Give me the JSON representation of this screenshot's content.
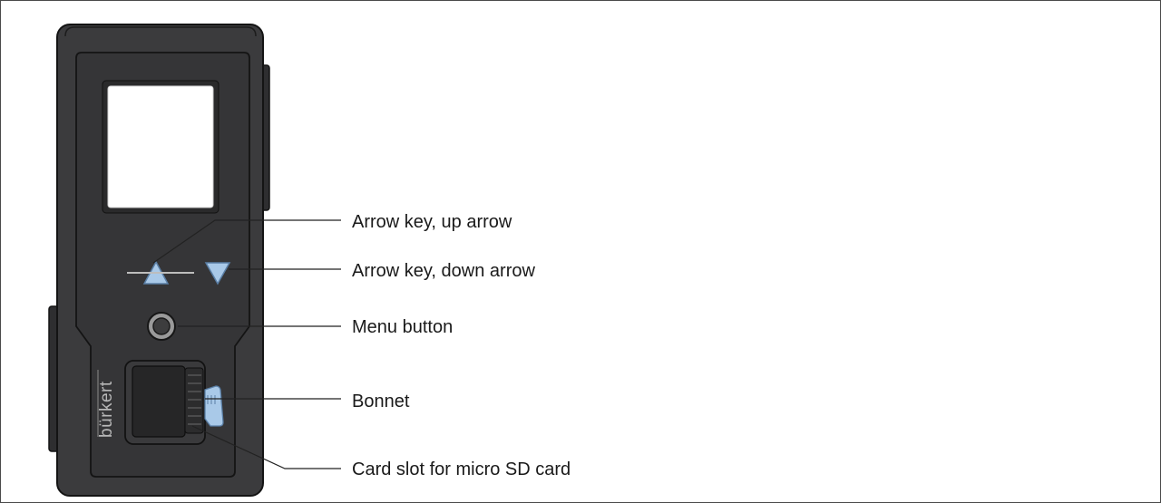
{
  "brand": {
    "logo_text": "bürkert"
  },
  "callouts": [
    {
      "id": "up",
      "label": "Arrow key, up arrow"
    },
    {
      "id": "down",
      "label": "Arrow key, down arrow"
    },
    {
      "id": "menu",
      "label": "Menu button"
    },
    {
      "id": "bonnet",
      "label": "Bonnet"
    },
    {
      "id": "sd",
      "label": "Card slot for micro SD card"
    }
  ],
  "colors": {
    "housing": "#3b3b3d",
    "panel": "#353537",
    "outline": "#141414",
    "key_fill": "#a9c9e8",
    "key_stroke": "#5a7fa6",
    "display": "#ffffff",
    "leader": "#222222"
  }
}
